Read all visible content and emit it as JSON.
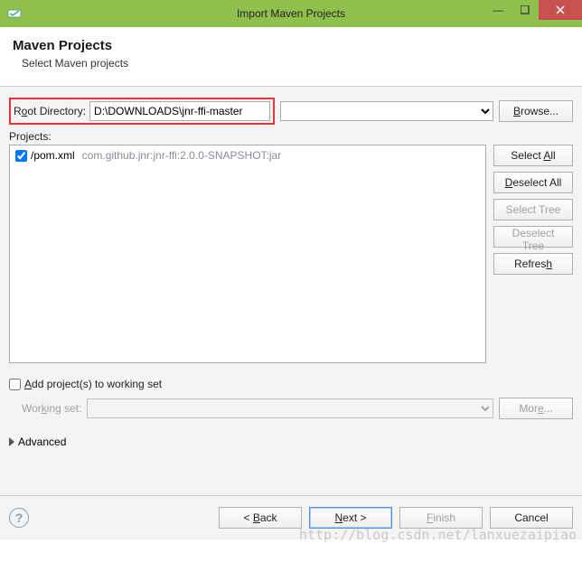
{
  "titlebar": {
    "title": "Import Maven Projects",
    "minimize": "—",
    "maximize": "□",
    "close": "✕"
  },
  "header": {
    "title": "Maven Projects",
    "subtitle": "Select Maven projects"
  },
  "rootDir": {
    "label_pre": "R",
    "label_u": "o",
    "label_post": "ot Directory:",
    "value": "D:\\DOWNLOADS\\jnr-ffi-master",
    "browse_u": "B",
    "browse_post": "rowse..."
  },
  "projects": {
    "label": "Projects:",
    "items": [
      {
        "checked": true,
        "path": "/pom.xml",
        "artifact": "com.github.jnr:jnr-ffi:2.0.0-SNAPSHOT:jar"
      }
    ]
  },
  "sideButtons": {
    "selectAll_pre": "Select ",
    "selectAll_u": "A",
    "selectAll_post": "ll",
    "deselectAll_u": "D",
    "deselectAll_post": "eselect All",
    "selectTree": "Select Tree",
    "deselectTree": "Deselect Tree",
    "refresh_pre": "Refres",
    "refresh_u": "h"
  },
  "workingSet": {
    "add_u": "A",
    "add_post": "dd project(s) to working set",
    "label_pre": "Wor",
    "label_u": "k",
    "label_post": "ing set:",
    "more_pre": "Mor",
    "more_u": "e",
    "more_post": "..."
  },
  "advanced": {
    "label": "Advanced"
  },
  "footer": {
    "back_pre": "< ",
    "back_u": "B",
    "back_post": "ack",
    "next_u": "N",
    "next_post": "ext >",
    "finish_u": "F",
    "finish_post": "inish",
    "cancel": "Cancel"
  },
  "watermark": "http://blog.csdn.net/lanxuezaipiao"
}
